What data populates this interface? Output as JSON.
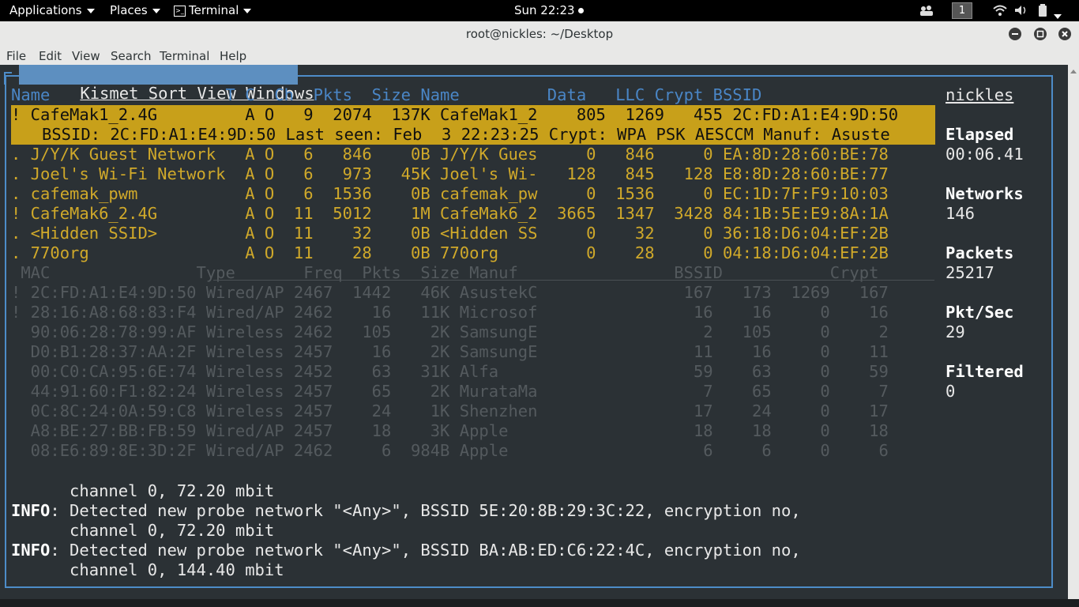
{
  "topbar": {
    "applications": "Applications",
    "places": "Places",
    "terminal": "Terminal",
    "clock": "Sun 22:23",
    "workspace": "1"
  },
  "window": {
    "title": "root@nickles: ~/Desktop"
  },
  "menubar": [
    "File",
    "Edit",
    "View",
    "Search",
    "Terminal",
    "Help"
  ],
  "kismet": {
    "menu": "Kismet Sort View Windows",
    "net_header": "Name                  T C  Ch  Pkts  Size Name         Data   LLC Crypt BSSID",
    "selected_row": "! CafeMak1_2.4G         A O   9  2074  137K CafeMak1_2    805  1269   455 2C:FD:A1:E4:9D:50",
    "selected_detail": "BSSID: 2C:FD:A1:E4:9D:50 Last seen: Feb  3 22:23:25 Crypt: WPA PSK AESCCM Manuf: Asuste",
    "networks": [
      ". J/Y/K Guest Network   A O   6   846    0B J/Y/K Gues     0   846     0 EA:8D:28:60:BE:78",
      ". Joel's Wi-Fi Network  A O   6   973   45K Joel's Wi-   128   845   128 E8:8D:28:60:BE:77",
      ". cafemak_pwm           A O   6  1536    0B cafemak_pw     0  1536     0 EC:1D:7F:F9:10:03",
      "! CafeMak6_2.4G         A O  11  5012    1M CafeMak6_2  3665  1347  3428 84:1B:5E:E9:8A:1A",
      ". <Hidden SSID>         A O  11    32    0B <Hidden SS     0    32     0 36:18:D6:04:EF:2B",
      ". 770org                A O  11    28    0B 770org         0    28     0 04:18:D6:04:EF:2B"
    ],
    "client_header": " MAC               Type       Freq  Pkts  Size Manuf                BSSID           Crypt",
    "clients": [
      "! 2C:FD:A1:E4:9D:50 Wired/AP 2467  1442   46K AsustekC               167   173  1269   167",
      "! 28:16:A8:68:83:F4 Wired/AP 2462    16   11K Microsof                16    16     0    16",
      "  90:06:28:78:99:AF Wireless 2462   105    2K SamsungE                 2   105     0     2",
      "  D0:B1:28:37:AA:2F Wireless 2457    16    2K SamsungE                11    16     0    11",
      "  00:C0:CA:95:6E:74 Wireless 2452    63   31K Alfa                    59    63     0    59",
      "  44:91:60:F1:82:24 Wireless 2457    65    2K MurataMa                 7    65     0     7",
      "  0C:8C:24:0A:59:C8 Wireless 2457    24    1K Shenzhen                17    24     0    17",
      "  A8:BE:27:BB:FB:59 Wired/AP 2457    18    3K Apple                   18    18     0    18",
      "  08:E6:89:8E:3D:2F Wired/AP 2462     6  984B Apple                    6     6     0     6"
    ],
    "side": {
      "host": "nickles",
      "elapsed_label": "Elapsed",
      "elapsed": "00:06.41",
      "networks_label": "Networks",
      "networks": "146",
      "packets_label": "Packets",
      "packets": "25217",
      "pktsec_label": "Pkt/Sec",
      "pktsec": "29",
      "filtered_label": "Filtered",
      "filtered": "0"
    },
    "log": [
      {
        "prefix": "",
        "text": "      channel 0, 72.20 mbit"
      },
      {
        "prefix": "INFO",
        "text": ": Detected new probe network \"<Any>\", BSSID 5E:20:8B:29:3C:22, encryption no,"
      },
      {
        "prefix": "",
        "text": "      channel 0, 72.20 mbit"
      },
      {
        "prefix": "INFO",
        "text": ": Detected new probe network \"<Any>\", BSSID BA:AB:ED:C6:22:4C, encryption no,"
      },
      {
        "prefix": "",
        "text": "      channel 0, 144.40 mbit"
      }
    ]
  }
}
